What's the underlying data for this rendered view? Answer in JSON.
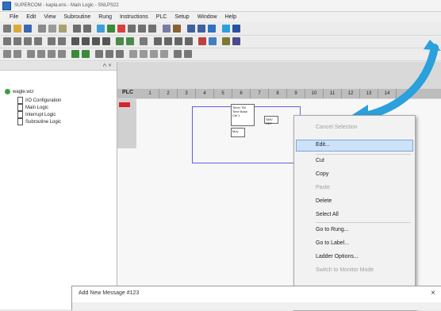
{
  "window": {
    "title": "SUPERCOM - kapla.ens - Main Logic - SNLPS22"
  },
  "menu": [
    "File",
    "Edit",
    "View",
    "Subroutine",
    "Rung",
    "Instructions",
    "PLC",
    "Setup",
    "Window",
    "Help"
  ],
  "tree": {
    "header": "ⵄ ✕",
    "root": "wagle.wcr",
    "items": [
      "I/O Configuration",
      "Main Logic",
      "Interrupt Logic",
      "Subroutine Logic"
    ]
  },
  "ladder": {
    "plc_label": "PLC",
    "column_headers": [
      "1",
      "2",
      "3",
      "4",
      "5",
      "6",
      "7",
      "8",
      "9",
      "10",
      "11",
      "12",
      "13",
      "14"
    ],
    "block_text": "Timer TM Time Base Ctrl 1",
    "block_text2": "Mov",
    "block_text3": "SMV REF"
  },
  "context_menu": {
    "items": [
      {
        "label": "Cancel Selection",
        "disabled": true
      },
      {
        "label": "Edit...",
        "highlighted": true
      },
      {
        "label": "Cut"
      },
      {
        "label": "Copy"
      },
      {
        "label": "Paste",
        "disabled": true
      },
      {
        "label": "Delete"
      },
      {
        "label": "Select All"
      },
      {
        "label": "Go to Rung..."
      },
      {
        "label": "Go to Label..."
      },
      {
        "label": "Ladder Options..."
      },
      {
        "label": "Switch to Monitor Mode",
        "disabled": true
      }
    ]
  },
  "dialog": {
    "title": "Add New Message #123",
    "close": "×"
  },
  "colors": {
    "arrow": "#2aa0dc",
    "rung_marker": "#d8232a",
    "highlight": "#cde1f8"
  }
}
